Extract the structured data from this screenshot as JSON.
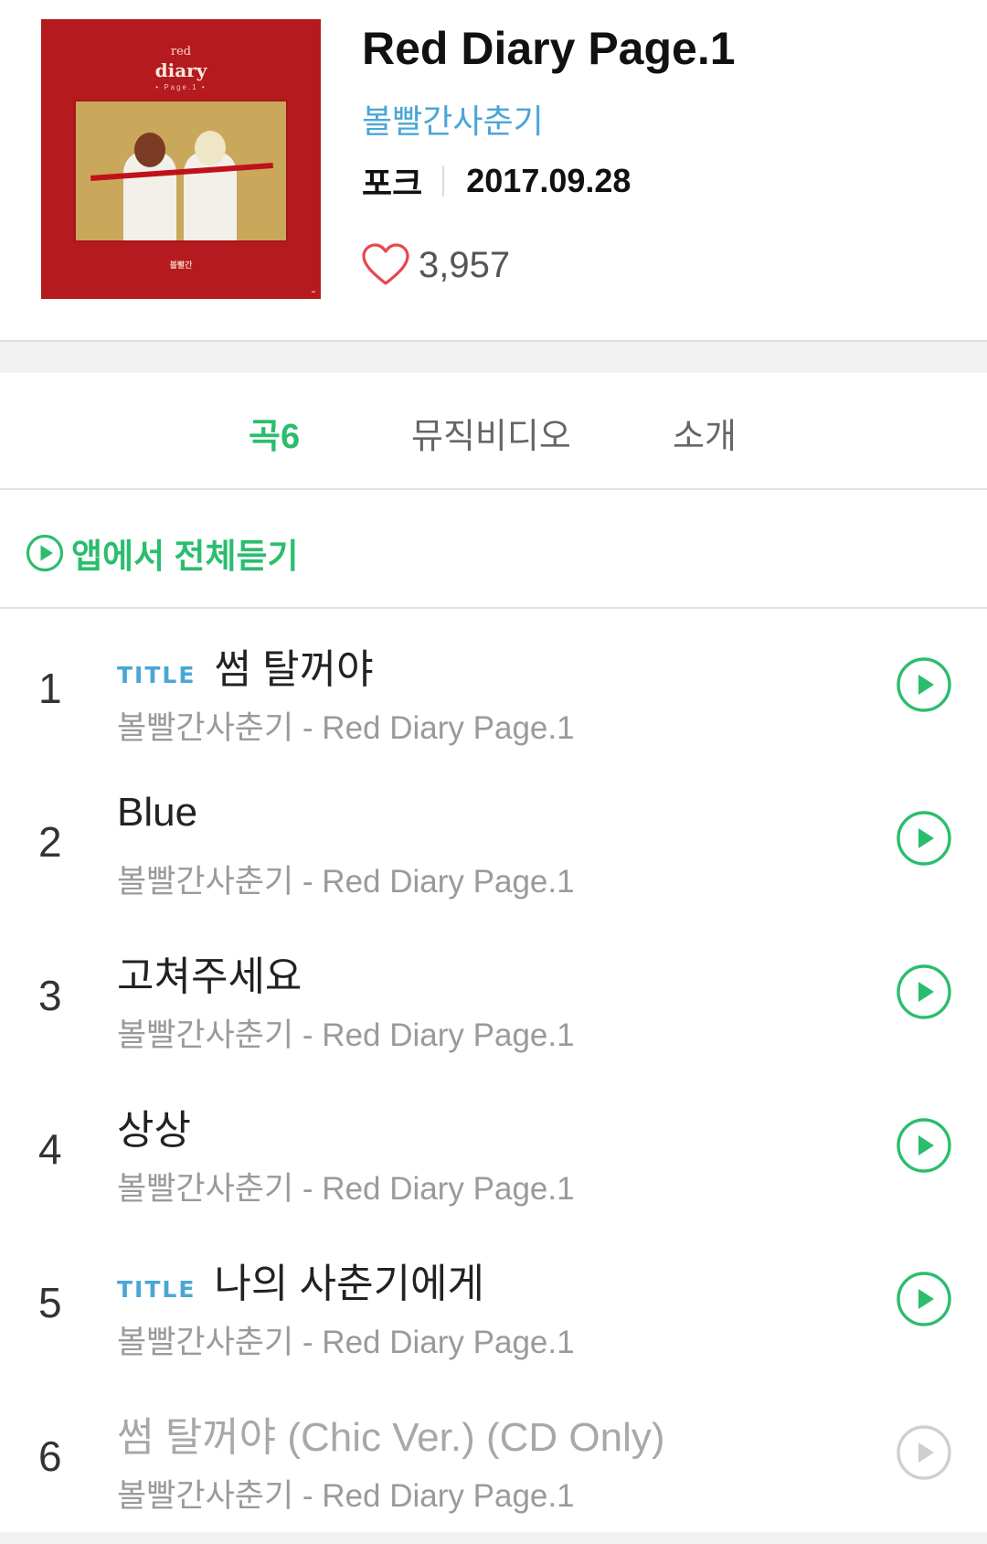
{
  "album": {
    "title": "Red Diary Page.1",
    "artist": "볼빨간사춘기",
    "genre": "포크",
    "release_date": "2017.09.28",
    "likes": "3,957",
    "cover": {
      "colors": {
        "background": "#b51a1e",
        "photo": "#c9a75b"
      }
    }
  },
  "tabs": [
    {
      "label": "곡",
      "count": "6",
      "active": true
    },
    {
      "label": "뮤직비디오",
      "active": false
    },
    {
      "label": "소개",
      "active": false
    }
  ],
  "play_all": {
    "label": "앱에서 전체듣기",
    "icon": "play-circle-icon"
  },
  "tracks": [
    {
      "number": "1",
      "badge": "TITLE",
      "title": "썸 탈꺼야",
      "subtitle": "볼빨간사춘기 - Red Diary Page.1",
      "playable": true
    },
    {
      "number": "2",
      "badge": "",
      "title": "Blue",
      "subtitle": "볼빨간사춘기 - Red Diary Page.1",
      "playable": true
    },
    {
      "number": "3",
      "badge": "",
      "title": "고쳐주세요",
      "subtitle": "볼빨간사춘기 - Red Diary Page.1",
      "playable": true
    },
    {
      "number": "4",
      "badge": "",
      "title": "상상",
      "subtitle": "볼빨간사춘기 - Red Diary Page.1",
      "playable": true
    },
    {
      "number": "5",
      "badge": "TITLE",
      "title": "나의 사춘기에게",
      "subtitle": "볼빨간사춘기 - Red Diary Page.1",
      "playable": true
    },
    {
      "number": "6",
      "badge": "",
      "title": "썸 탈꺼야 (Chic Ver.) (CD Only)",
      "subtitle": "볼빨간사춘기 - Red Diary Page.1",
      "playable": false
    }
  ],
  "colors": {
    "accent_green": "#2bbd6e",
    "artist_blue": "#4aa6d6",
    "heart_red": "#e8474f",
    "disabled_gray": "#cfcfcf"
  }
}
